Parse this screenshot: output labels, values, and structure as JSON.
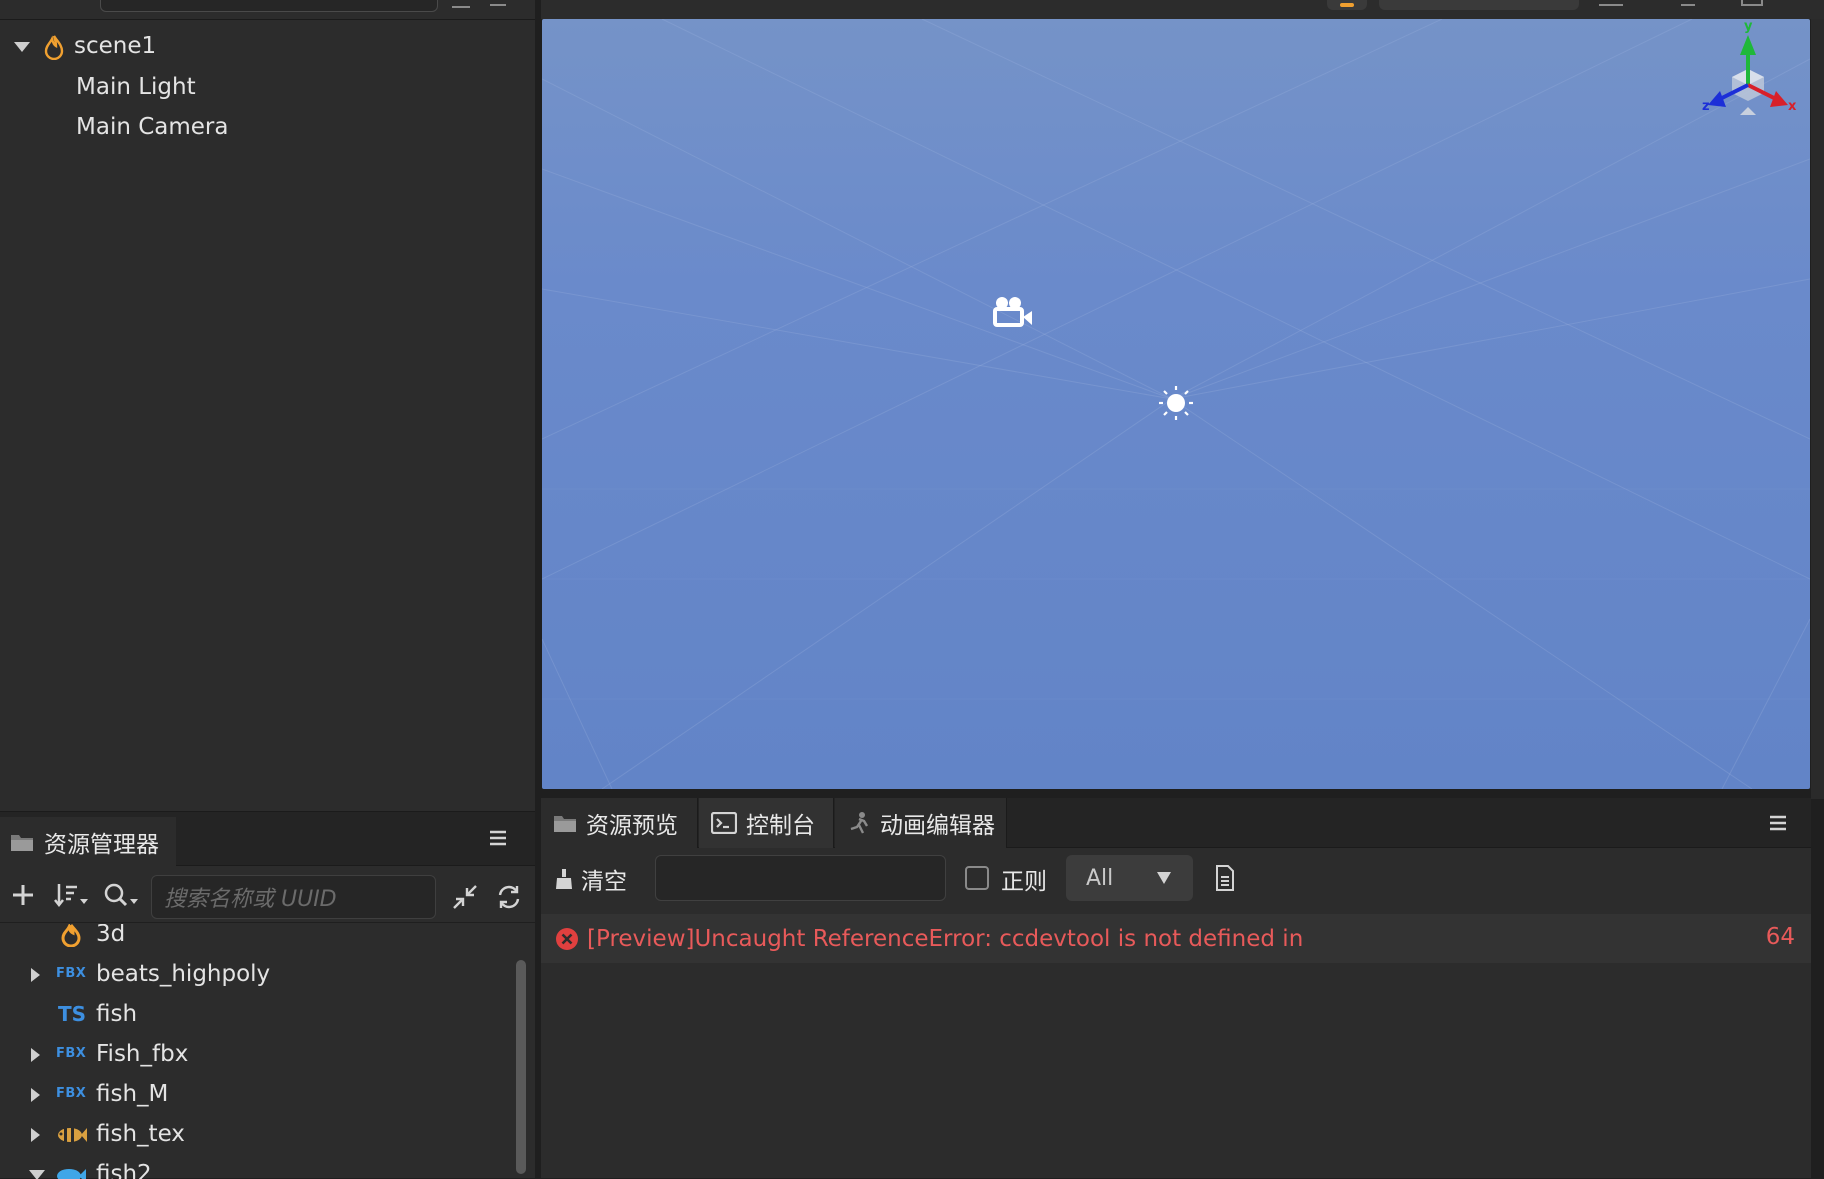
{
  "hierarchy": {
    "scene_name": "scene1",
    "children": [
      "Main Light",
      "Main Camera"
    ]
  },
  "assets": {
    "tab_label": "资源管理器",
    "search_placeholder": "搜索名称或 UUID",
    "items": [
      {
        "name": "3d",
        "type": "folder"
      },
      {
        "name": "beats_highpoly",
        "type": "fbx",
        "badge": "FBX"
      },
      {
        "name": "fish",
        "type": "ts",
        "badge": "TS"
      },
      {
        "name": "Fish_fbx",
        "type": "fbx",
        "badge": "FBX"
      },
      {
        "name": "fish_M",
        "type": "fbx",
        "badge": "FBX"
      },
      {
        "name": "fish_tex",
        "type": "texture"
      },
      {
        "name": "fish2",
        "type": "prefab"
      }
    ]
  },
  "console": {
    "tabs": [
      "资源预览",
      "控制台",
      "动画编辑器"
    ],
    "clear_label": "清空",
    "regex_label": "正则",
    "level_select": "All",
    "log": {
      "message": "[Preview]Uncaught ReferenceError: ccdevtool is not defined in",
      "count": "64",
      "level": "error"
    }
  },
  "gizmo": {
    "x_label": "x",
    "y_label": "y",
    "z_label": "z"
  },
  "colors": {
    "accent_orange": "#f0a030",
    "error_red": "#e85a5a",
    "fbx_blue": "#3d8fe0",
    "viewport_blue": "#6a8acb"
  }
}
